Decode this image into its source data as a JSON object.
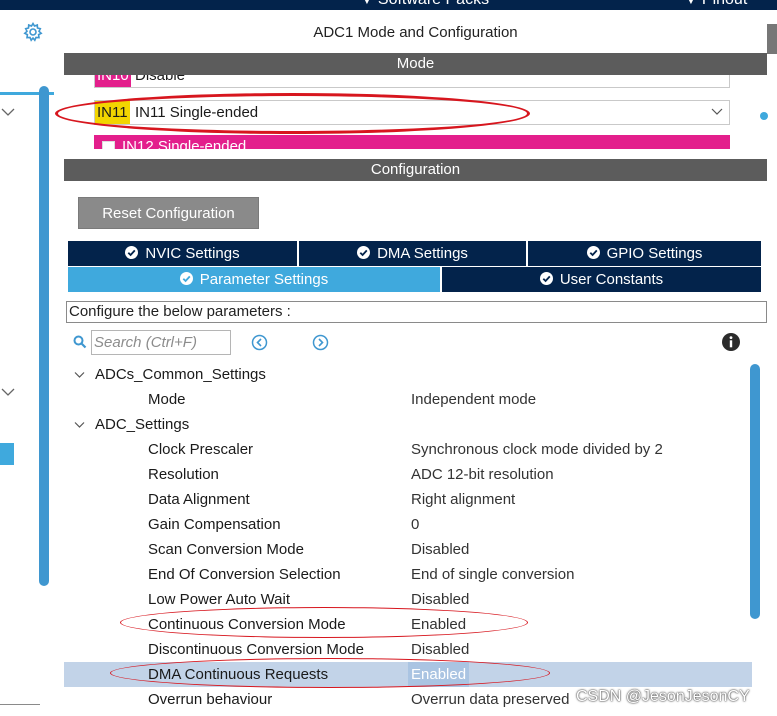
{
  "topbar": {
    "software_packs": "Software Packs",
    "pinout": "Pinout"
  },
  "main": {
    "title": "ADC1 Mode and Configuration",
    "mode_header": "Mode",
    "config_header": "Configuration",
    "mode_rows": [
      {
        "tag": "IN10",
        "value": "Disable"
      },
      {
        "tag": "IN11",
        "value": "IN11 Single-ended"
      },
      {
        "tag": "",
        "value": "IN12 Single-ended"
      }
    ],
    "reset_label": "Reset Configuration",
    "tabs": {
      "nvic": "NVIC Settings",
      "dma": "DMA Settings",
      "gpio": "GPIO Settings",
      "parameter": "Parameter Settings",
      "user_constants": "User Constants"
    },
    "configure_label": "Configure the below parameters :",
    "search_placeholder": "Search (Ctrl+F)"
  },
  "tree": {
    "groups": [
      {
        "name": "ADCs_Common_Settings",
        "items": [
          {
            "name": "Mode",
            "value": "Independent mode"
          }
        ]
      },
      {
        "name": "ADC_Settings",
        "items": [
          {
            "name": "Clock Prescaler",
            "value": "Synchronous clock mode divided by 2"
          },
          {
            "name": "Resolution",
            "value": "ADC 12-bit resolution"
          },
          {
            "name": "Data Alignment",
            "value": "Right alignment"
          },
          {
            "name": "Gain Compensation",
            "value": "0"
          },
          {
            "name": "Scan Conversion Mode",
            "value": "Disabled"
          },
          {
            "name": "End Of Conversion Selection",
            "value": "End of single conversion"
          },
          {
            "name": "Low Power Auto Wait",
            "value": "Disabled"
          },
          {
            "name": "Continuous Conversion Mode",
            "value": "Enabled"
          },
          {
            "name": "Discontinuous Conversion Mode",
            "value": "Disabled"
          },
          {
            "name": "DMA Continuous Requests",
            "value": "Enabled"
          },
          {
            "name": "Overrun behaviour",
            "value": "Overrun data preserved"
          }
        ]
      }
    ]
  },
  "watermark": "CSDN @JesonJesonCY",
  "colors": {
    "navy": "#03234b",
    "accent_blue": "#3fa9dd",
    "section_gray": "#5c5c5c",
    "tag_yellow": "#f2d500",
    "pin_magenta": "#e31f8c",
    "selected_row": "#c2d3e8",
    "annotation_red": "#d7161e"
  }
}
